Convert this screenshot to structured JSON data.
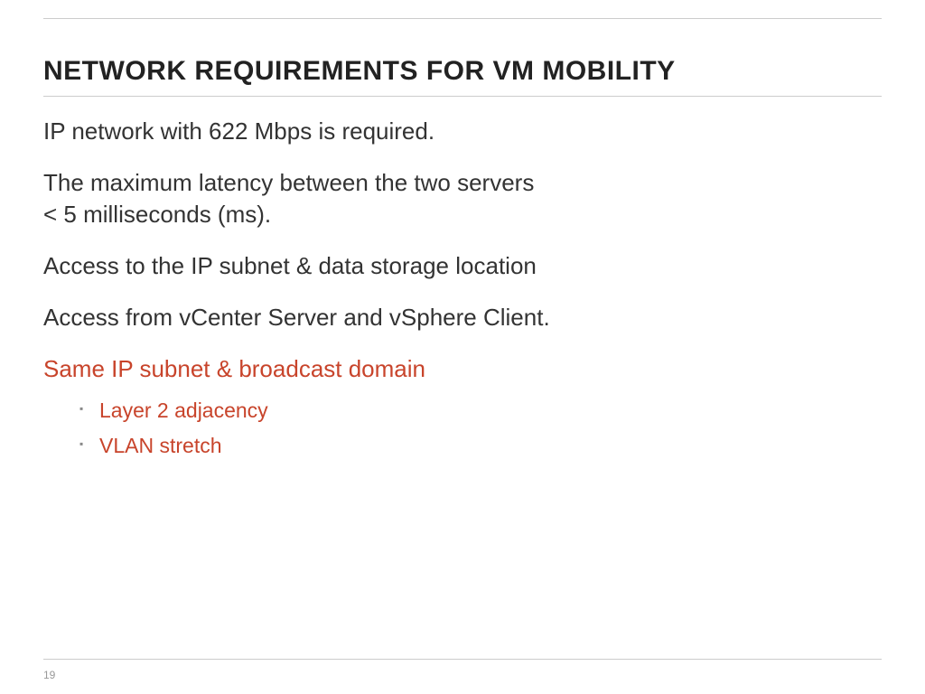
{
  "title": "NETWORK REQUIREMENTS FOR VM MOBILITY",
  "paragraphs": {
    "p1": "IP network with 622 Mbps is required.",
    "p2a": "The maximum latency between the two servers",
    "p2b": "< 5 milliseconds (ms).",
    "p3": "Access to the IP subnet & data storage location",
    "p4": "Access from vCenter Server and vSphere Client.",
    "p5": "Same IP subnet & broadcast domain"
  },
  "sublist": {
    "i1": "Layer 2 adjacency",
    "i2": "VLAN stretch"
  },
  "page_number": "19"
}
